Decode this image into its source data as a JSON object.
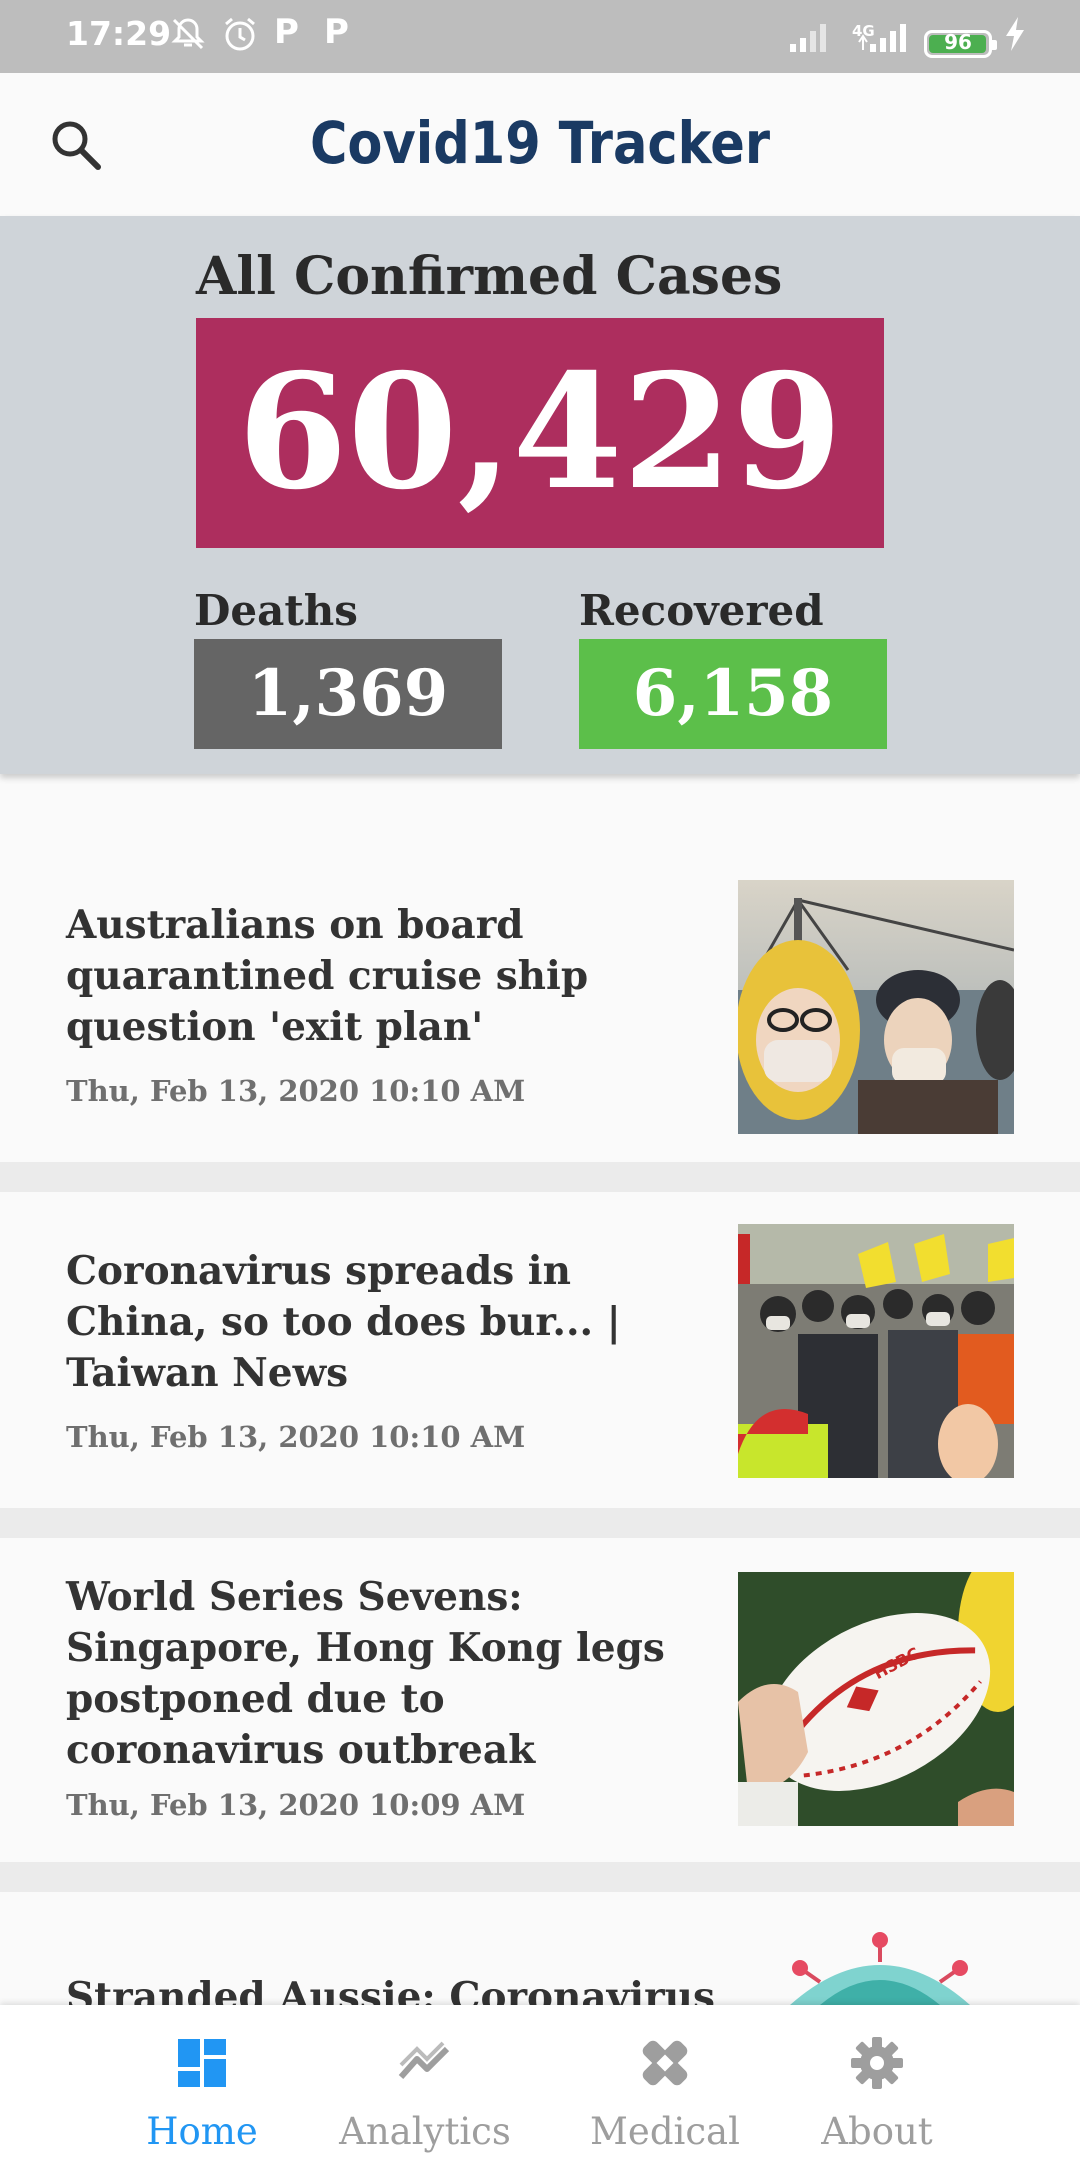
{
  "status_bar": {
    "time": "17:29",
    "p1": "P",
    "p2": "P",
    "network": "4G",
    "battery": "96"
  },
  "app_bar": {
    "title": "Covid19 Tracker",
    "search_icon": "search-icon"
  },
  "stats": {
    "confirmed_label": "All Confirmed Cases",
    "confirmed_value": "60,429",
    "deaths_label": "Deaths",
    "deaths_value": "1,369",
    "recovered_label": "Recovered",
    "recovered_value": "6,158",
    "colors": {
      "confirmed": "#ad2e5e",
      "deaths": "#656565",
      "recovered": "#5cbf4a"
    }
  },
  "news": [
    {
      "title": "Australians on board quarantined cruise ship question 'exit plan'",
      "date": "Thu, Feb 13, 2020 10:10 AM"
    },
    {
      "title": "Coronavirus spreads in China, so too does bur... | Taiwan News",
      "date": "Thu, Feb 13, 2020 10:10 AM"
    },
    {
      "title": "World Series Sevens: Singapore, Hong Kong legs postponed due to coronavirus outbreak",
      "date": "Thu, Feb 13, 2020 10:09 AM"
    },
    {
      "title": "Stranded Aussie: Coronavirus",
      "date": ""
    }
  ],
  "bottom_nav": {
    "items": [
      {
        "label": "Home",
        "icon": "dashboard-icon",
        "active": true
      },
      {
        "label": "Analytics",
        "icon": "trending-icon",
        "active": false
      },
      {
        "label": "Medical",
        "icon": "bandage-icon",
        "active": false
      },
      {
        "label": "About",
        "icon": "gear-icon",
        "active": false
      }
    ],
    "active_color": "#2196f3"
  }
}
